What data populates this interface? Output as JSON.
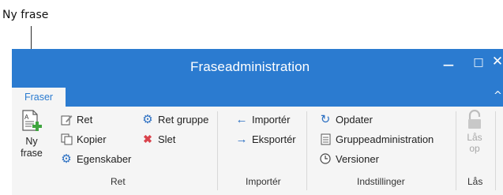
{
  "callout": {
    "label": "Ny frase"
  },
  "window": {
    "title": "Fraseadministration",
    "minimize_glyph": "−",
    "maximize_glyph": "□",
    "close_glyph": "✕",
    "collapse_glyph": "^"
  },
  "tabs": [
    {
      "label": "Fraser",
      "active": true
    }
  ],
  "ribbon": {
    "groups": {
      "ret": {
        "label": "Ret",
        "ny_frase_line1": "Ny",
        "ny_frase_line2": "frase",
        "items": {
          "ret": "Ret",
          "kopier": "Kopier",
          "egenskaber": "Egenskaber",
          "ret_gruppe": "Ret gruppe",
          "slet": "Slet"
        }
      },
      "importer": {
        "label": "Importér",
        "items": {
          "importer": "Importér",
          "eksporter": "Eksportér"
        }
      },
      "indstillinger": {
        "label": "Indstillinger",
        "items": {
          "opdater": "Opdater",
          "gruppeadministration": "Gruppeadministration",
          "versioner": "Versioner"
        }
      },
      "laas": {
        "label": "Lås",
        "button_line1": "Lås",
        "button_line2": "op"
      }
    }
  },
  "colors": {
    "titlebar": "#2b7bd0",
    "ribbon_bg": "#f5f5f5",
    "gear_blue": "#2b6fc2",
    "delete_red": "#d9434c",
    "add_green": "#3fa53f"
  }
}
